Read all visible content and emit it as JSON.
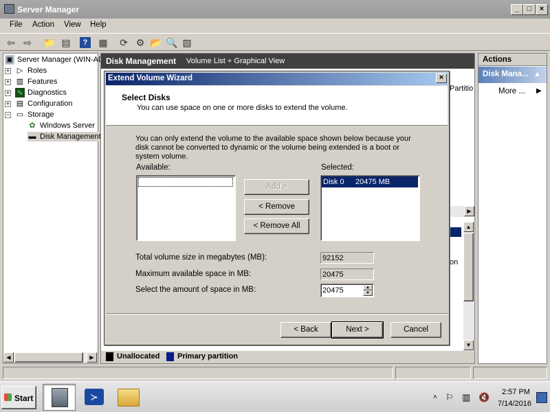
{
  "window": {
    "title": "Server Manager"
  },
  "menu": [
    "File",
    "Action",
    "View",
    "Help"
  ],
  "tree": {
    "root": "Server Manager (WIN-AD",
    "items": [
      "Roles",
      "Features",
      "Diagnostics",
      "Configuration",
      "Storage"
    ],
    "storage_children": [
      "Windows Server",
      "Disk Management"
    ]
  },
  "center": {
    "title": "Disk Management",
    "subtitle": "Volume List + Graphical View",
    "partial_right_1": "Partitio",
    "partial_right_2": "on",
    "legend": [
      "Unallocated",
      "Primary partition"
    ]
  },
  "actions": {
    "title": "Actions",
    "section": "Disk Mana...",
    "more": "More ..."
  },
  "wizard": {
    "title": "Extend Volume Wizard",
    "heading": "Select Disks",
    "subheading": "You can use space on one or more disks to extend the volume.",
    "info": "You can only extend the volume to the available space shown below because your disk cannot be converted to dynamic or the volume being extended is a boot or system volume.",
    "available_label": "Available:",
    "selected_label": "Selected:",
    "selected_items": [
      {
        "disk": "Disk 0",
        "size": "20475 MB"
      }
    ],
    "add_label": "Add >",
    "remove_label": "< Remove",
    "remove_all_label": "< Remove All",
    "total_label": "Total volume size in megabytes (MB):",
    "total_value": "92152",
    "max_label": "Maximum available space in MB:",
    "max_value": "20475",
    "amount_label": "Select the amount of space in MB:",
    "amount_value": "20475",
    "back_label": "< Back",
    "next_label": "Next >",
    "cancel_label": "Cancel"
  },
  "taskbar": {
    "start": "Start",
    "time": "2:57 PM",
    "date": "7/14/2016"
  }
}
